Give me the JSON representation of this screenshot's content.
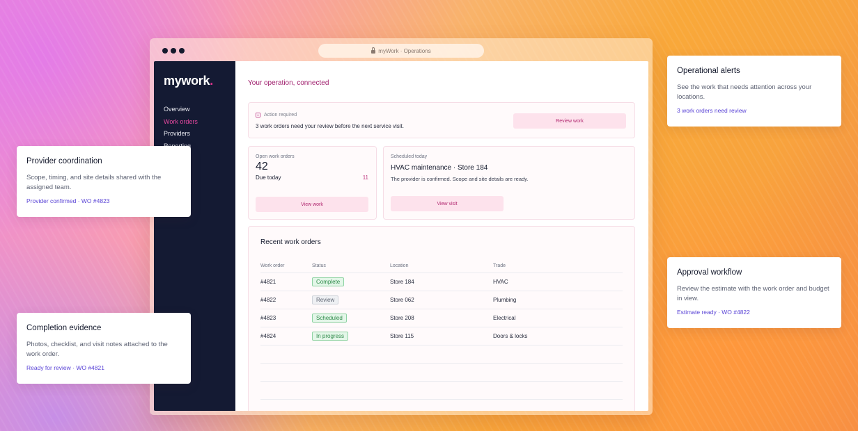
{
  "browser": {
    "url": "myWork · Operations"
  },
  "sidebar": {
    "logo": "mywork",
    "logo_dot": ".",
    "items": [
      {
        "label": "Overview"
      },
      {
        "label": "Work orders"
      },
      {
        "label": "Providers"
      },
      {
        "label": "Reporting"
      }
    ]
  },
  "main": {
    "heading": "Your operation, connected",
    "alert": {
      "label": "Action required",
      "text": "3 work orders need your review before the next service visit.",
      "button": "Review work"
    },
    "open_orders": {
      "label": "Open work orders",
      "count": "42",
      "due_label": "Due today",
      "due_count": "11",
      "button": "View work"
    },
    "scheduled": {
      "label": "Scheduled today",
      "title": "HVAC maintenance · Store 184",
      "description": "The provider is confirmed. Scope and site details are ready.",
      "button": "View visit"
    },
    "recent": {
      "title": "Recent work orders",
      "columns": [
        "Work order",
        "Status",
        "Location",
        "Trade"
      ],
      "rows": [
        {
          "order": "#4821",
          "status": "Complete",
          "location": "Store 184",
          "trade": "HVAC"
        },
        {
          "order": "#4822",
          "status": "Review",
          "location": "Store 062",
          "trade": "Plumbing"
        },
        {
          "order": "#4823",
          "status": "Scheduled",
          "location": "Store 208",
          "trade": "Electrical"
        },
        {
          "order": "#4824",
          "status": "In progress",
          "location": "Store 115",
          "trade": "Doors & locks"
        }
      ]
    }
  },
  "status_colors": {
    "Complete": {
      "bg": "#e3f6e8",
      "border": "#8fd3a2",
      "text": "#2f8a49"
    },
    "Review": {
      "bg": "#eef0f3",
      "border": "#cfd3da",
      "text": "#5f6572"
    },
    "Scheduled": {
      "bg": "#e3f6e8",
      "border": "#8fd3a2",
      "text": "#2f8a49"
    },
    "In progress": {
      "bg": "#e3f6e8",
      "border": "#8fd3a2",
      "text": "#2f8a49"
    }
  },
  "floating_cards": {
    "provider": {
      "title": "Provider coordination",
      "description": "Scope, timing, and site details shared with the assigned team.",
      "link": "Provider confirmed · WO #4823"
    },
    "completion": {
      "title": "Completion evidence",
      "description": "Photos, checklist, and visit notes attached to the work order.",
      "link": "Ready for review · WO #4821"
    },
    "alerts": {
      "title": "Operational alerts",
      "description": "See the work that needs attention across your locations.",
      "link": "3 work orders need review"
    },
    "approval": {
      "title": "Approval workflow",
      "description": "Review the estimate with the work order and budget in view.",
      "link": "Estimate ready · WO #4822"
    }
  }
}
